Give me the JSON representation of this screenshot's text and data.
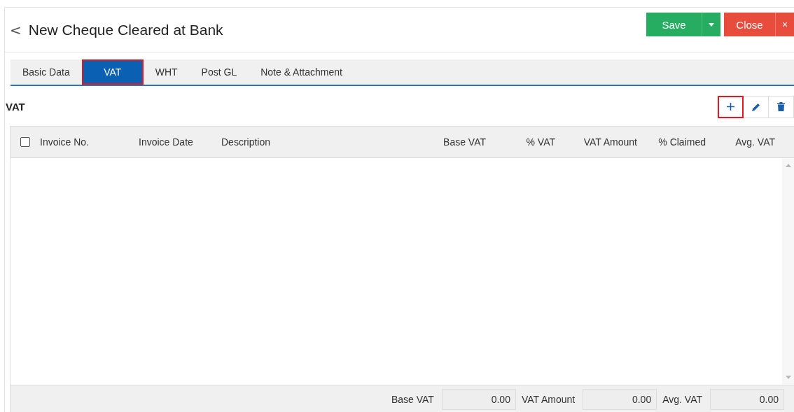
{
  "header": {
    "back_icon": "<",
    "title": "New Cheque Cleared at Bank",
    "buttons": [
      {
        "kind": "save",
        "label": "Save"
      },
      {
        "kind": "close",
        "label": "Close",
        "close_glyph": "×"
      }
    ]
  },
  "tabs": [
    {
      "label": "Basic Data",
      "selected": false,
      "highlighted": false
    },
    {
      "label": "VAT",
      "selected": true,
      "highlighted": true
    },
    {
      "label": "WHT",
      "selected": false,
      "highlighted": false
    },
    {
      "label": "Post GL",
      "selected": false,
      "highlighted": false
    },
    {
      "label": "Note & Attachment",
      "selected": false,
      "highlighted": false
    }
  ],
  "section": {
    "title": "VAT",
    "toolbar": [
      {
        "kind": "add",
        "highlighted": true
      },
      {
        "kind": "edit",
        "highlighted": false
      },
      {
        "kind": "delete",
        "highlighted": false
      }
    ]
  },
  "table": {
    "select_all_checked": false,
    "columns": [
      "Invoice No.",
      "Invoice Date",
      "Description",
      "Base VAT",
      "% VAT",
      "VAT Amount",
      "% Claimed",
      "Avg. VAT"
    ]
  },
  "totals": [
    {
      "label": "Base VAT",
      "value": "0.00"
    },
    {
      "label": "VAT Amount",
      "value": "0.00"
    },
    {
      "label": "Avg. VAT",
      "value": "0.00"
    }
  ]
}
